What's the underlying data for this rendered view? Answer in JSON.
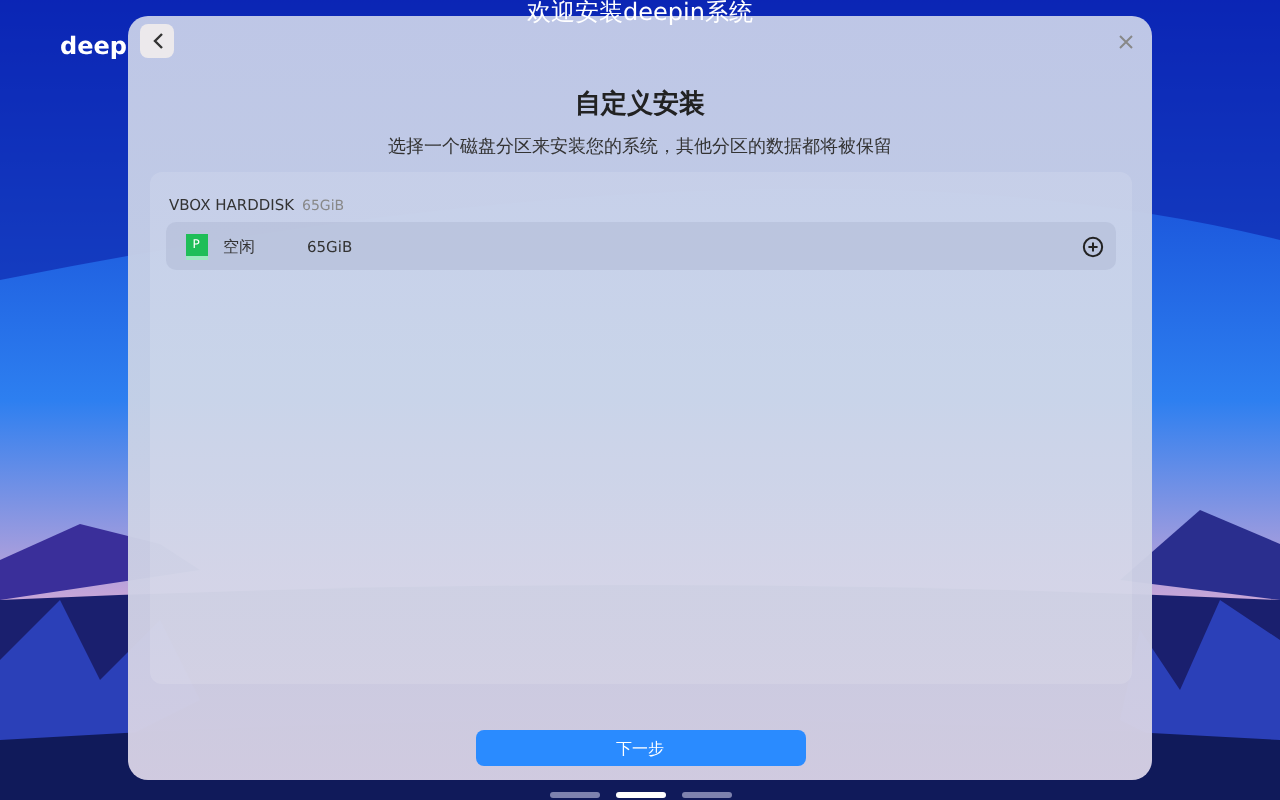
{
  "desktop": {
    "title": "欢迎安装deepin系统",
    "logo": "deep",
    "pages": [
      {
        "selected": false
      },
      {
        "selected": true
      },
      {
        "selected": false
      }
    ]
  },
  "dialog": {
    "title": "自定义安装",
    "subtitle": "选择一个磁盘分区来安装您的系统，其他分区的数据都将被保留",
    "disks": [
      {
        "name": "VBOX HARDDISK",
        "size": "65GiB",
        "partitions": [
          {
            "badge": "P",
            "label": "空闲",
            "size": "65GiB",
            "selected": false
          }
        ]
      }
    ],
    "next_button": "下一步"
  }
}
